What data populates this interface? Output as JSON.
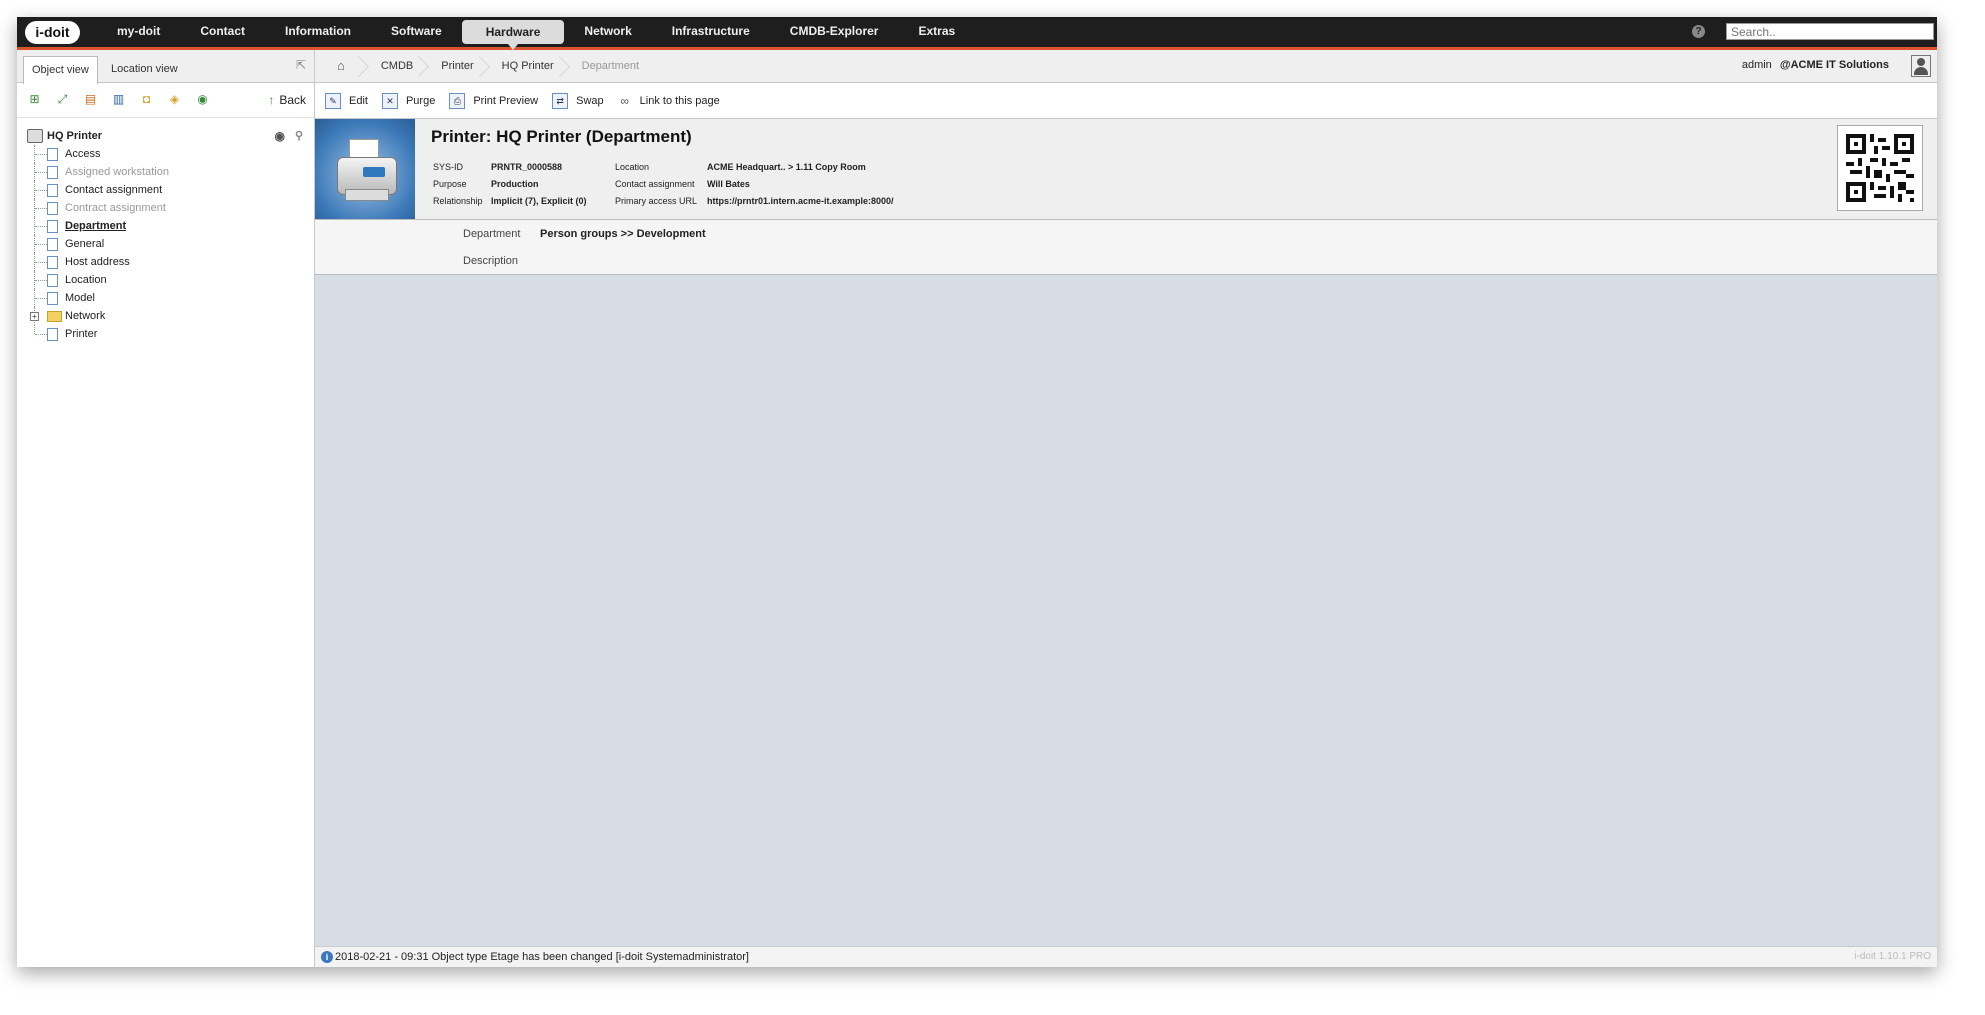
{
  "app": {
    "logo_text": "i-doit",
    "brand_color": "#d9552b"
  },
  "nav": {
    "items": [
      "my-doit",
      "Contact",
      "Information",
      "Software",
      "Hardware",
      "Network",
      "Infrastructure",
      "CMDB-Explorer",
      "Extras"
    ],
    "active": "Hardware",
    "help_label": "?",
    "search_placeholder": "Search.."
  },
  "left": {
    "tabs": {
      "object_view": "Object view",
      "location_view": "Location view"
    },
    "back_label": "Back",
    "tree_root": "HQ Printer",
    "tree_items": [
      {
        "label": "Access",
        "state": "normal"
      },
      {
        "label": "Assigned workstation",
        "state": "disabled"
      },
      {
        "label": "Contact assignment",
        "state": "normal"
      },
      {
        "label": "Contract assignment",
        "state": "disabled"
      },
      {
        "label": "Department",
        "state": "selected"
      },
      {
        "label": "General",
        "state": "normal"
      },
      {
        "label": "Host address",
        "state": "normal"
      },
      {
        "label": "Location",
        "state": "normal"
      },
      {
        "label": "Model",
        "state": "normal"
      },
      {
        "label": "Network",
        "state": "folder"
      },
      {
        "label": "Printer",
        "state": "normal"
      }
    ]
  },
  "breadcrumb": [
    "CMDB",
    "Printer",
    "HQ Printer",
    "Department"
  ],
  "user": {
    "name": "admin",
    "tenant": "ACME IT Solutions",
    "at": "@"
  },
  "actions": {
    "edit": "Edit",
    "purge": "Purge",
    "print_preview": "Print Preview",
    "swap": "Swap",
    "link": "Link to this page"
  },
  "object": {
    "title": "Printer: HQ Printer (Department)",
    "sys_id_label": "SYS-ID",
    "sys_id": "PRNTR_0000588",
    "purpose_label": "Purpose",
    "purpose": "Production",
    "relationship_label": "Relationship",
    "relationship": "Implicit (7), Explicit (0)",
    "location_label": "Location",
    "location": "ACME Headquart.. > 1.11 Copy Room",
    "contact_label": "Contact assignment",
    "contact": "Will Bates",
    "url_label": "Primary access URL",
    "url": "https://prntr01.intern.acme-it.example:8000/"
  },
  "form": {
    "department_label": "Department",
    "department_value": "Person groups >> Development",
    "description_label": "Description"
  },
  "status": {
    "icon": "i",
    "message": "2018-02-21 - 09:31 Object type Etage has been changed [i-doit Systemadministrator]",
    "version": "i-doit 1.10.1 PRO"
  }
}
